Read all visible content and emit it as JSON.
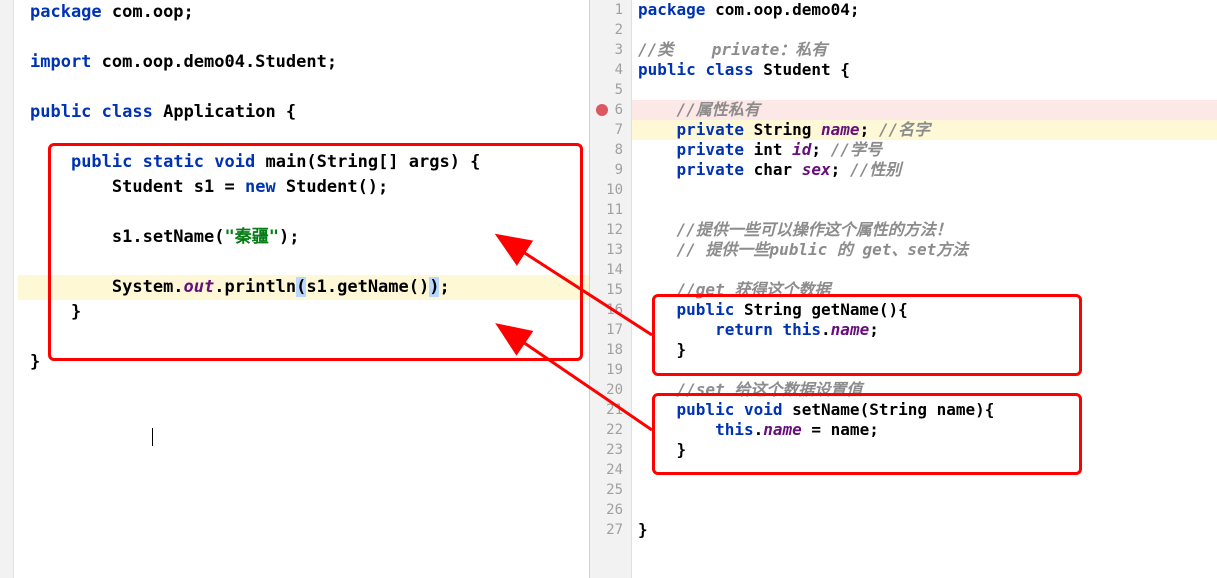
{
  "left": {
    "lines": {
      "l1_kw": "package",
      "l1_rest": " com.oop;",
      "l3_kw": "import",
      "l3_rest": " com.oop.demo04.Student;",
      "l5_kw1": "public",
      "l5_kw2": "class",
      "l5_rest": " Application {",
      "l7_kw1": "public",
      "l7_kw2": "static",
      "l7_kw3": "void",
      "l7_main": " main(String[] args) {",
      "l8_type": "Student",
      "l8_var": " s1 = ",
      "l8_kw": "new",
      "l8_rest": " Student();",
      "l10": "s1.setName(",
      "l10_str": "\"秦疆\"",
      "l10_end": ");",
      "l12_pre": "System.",
      "l12_out": "out",
      "l12_mid": ".println",
      "l12_open": "(",
      "l12_call": "s1.getName()",
      "l12_close": ")",
      "l12_semi": ";",
      "l13": "}",
      "l15": "}"
    }
  },
  "right": {
    "line_numbers": [
      "1",
      "2",
      "3",
      "4",
      "5",
      "6",
      "7",
      "8",
      "9",
      "10",
      "11",
      "12",
      "13",
      "14",
      "15",
      "16",
      "17",
      "18",
      "19",
      "20",
      "21",
      "22",
      "23",
      "24",
      "25",
      "26",
      "27"
    ],
    "l1_kw": "package",
    "l1_rest": " com.oop.demo04;",
    "l3_cmt": "//类    private：私有",
    "l4_kw1": "public",
    "l4_kw2": "class",
    "l4_rest": " Student {",
    "l6_cmt": "//属性私有",
    "l7_kw": "private",
    "l7_type": " String ",
    "l7_field": "name",
    "l7_semi": "; ",
    "l7_cmt": "//名字",
    "l8_kw": "private",
    "l8_type": " int ",
    "l8_field": "id",
    "l8_semi": "; ",
    "l8_cmt": "//学号",
    "l9_kw": "private",
    "l9_type": " char ",
    "l9_field": "sex",
    "l9_semi": "; ",
    "l9_cmt": "//性别",
    "l12_cmt": "//提供一些可以操作这个属性的方法！",
    "l13_cmt": "// 提供一些public 的 get、set方法",
    "l15_cmt": "//get 获得这个数据",
    "l16_kw": "public",
    "l16_type": " String ",
    "l16_method": "getName(){",
    "l17_kw": "return",
    "l17_this": " this",
    "l17_dot": ".",
    "l17_field": "name",
    "l17_semi": ";",
    "l18": "}",
    "l20_cmt": "//set 给这个数据设置值",
    "l21_kw": "public",
    "l21_kw2": "void",
    "l21_method": " setName(String name){",
    "l22_this": "this",
    "l22_dot": ".",
    "l22_field": "name",
    "l22_assign": " = name;",
    "l23": "}",
    "l27": "}"
  },
  "chart_data": null
}
